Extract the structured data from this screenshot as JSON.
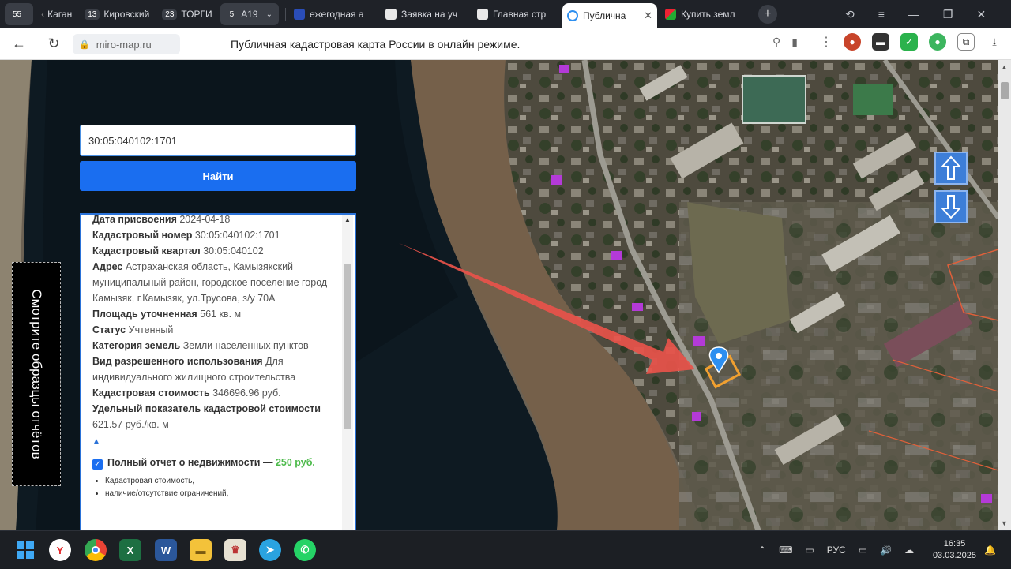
{
  "tabs": [
    {
      "num": "55",
      "label": "",
      "kind": "group"
    },
    {
      "num": "",
      "label": "Каган",
      "kind": "group"
    },
    {
      "num": "13",
      "label": "Кировский",
      "kind": "group"
    },
    {
      "num": "23",
      "label": "ТОРГИ",
      "kind": "group"
    },
    {
      "num": "5",
      "label": "А19",
      "kind": "group-open"
    },
    {
      "num": "",
      "label": "ежегодная а",
      "kind": "tab"
    },
    {
      "num": "",
      "label": "Заявка на уч",
      "kind": "tab"
    },
    {
      "num": "",
      "label": "Главная стр",
      "kind": "tab"
    },
    {
      "num": "",
      "label": "Публична",
      "kind": "active"
    },
    {
      "num": "",
      "label": "Купить земл",
      "kind": "tab"
    }
  ],
  "address": {
    "url": "miro-map.ru",
    "page_title": "Публичная кадастровая карта России в онлайн режиме."
  },
  "search": {
    "value": "30:05:040102:1701",
    "button": "Найти"
  },
  "info": {
    "date_label": "Дата присвоения",
    "date_value": "2024-04-18",
    "cad_num_label": "Кадастровый номер",
    "cad_num_value": "30:05:040102:1701",
    "quarter_label": "Кадастровый квартал",
    "quarter_value": "30:05:040102",
    "address_label": "Адрес",
    "address_value": "Астраханская область, Камызякский муниципальный район, городское поселение город Камызяк, г.Камызяк, ул.Трусова, з/у 70А",
    "area_label": "Площадь уточненная",
    "area_value": "561 кв. м",
    "status_label": "Статус",
    "status_value": "Учтенный",
    "category_label": "Категория земель",
    "category_value": "Земли населенных пунктов",
    "use_label": "Вид разрешенного использования",
    "use_value": "Для индивидуального жилищного строительства",
    "cost_label": "Кадастровая стоимость",
    "cost_value": "346696.96 руб.",
    "specific_label": "Удельный показатель кадастровой стоимости",
    "specific_value": "621.57 руб./кв. м",
    "report_label": "Полный отчет о недвижимости —",
    "report_price": "250 руб.",
    "bullets": [
      "Кадастровая стоимость,",
      "наличие/отсутствие ограничений,"
    ]
  },
  "side_button": "Смотрите образцы отчётов",
  "taskbar": {
    "lang": "РУС",
    "time": "16:35",
    "date": "03.03.2025"
  },
  "colors": {
    "accent": "#1a6ef0",
    "arrow": "#e8534a",
    "parcel": "#f0a030",
    "marker": "#2d8ff0"
  }
}
